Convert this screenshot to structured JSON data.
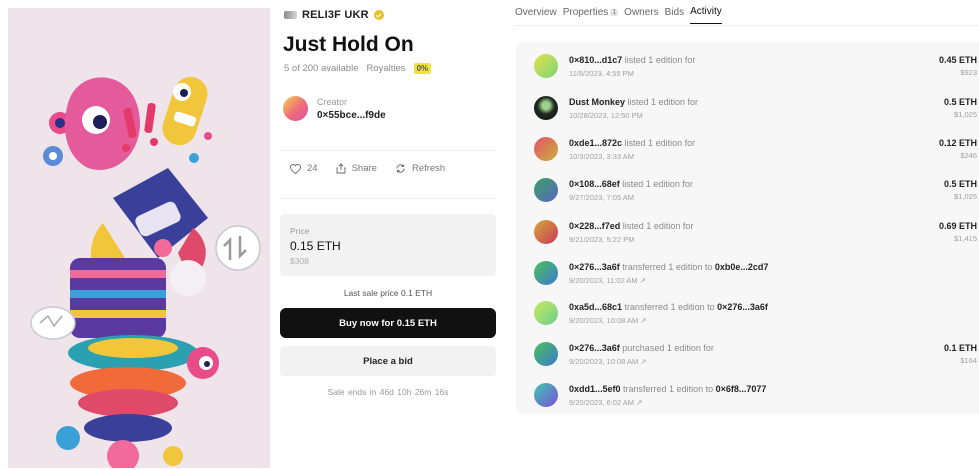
{
  "artist": {
    "name": "RELI3F UKR"
  },
  "item": {
    "title": "Just Hold On",
    "availability": "5 of 200 available",
    "royalties_label": "Royalties",
    "royalties_value": "0%"
  },
  "creator": {
    "label": "Creator",
    "address": "0×55bce...f9de"
  },
  "actions": {
    "likes": "24",
    "share": "Share",
    "refresh": "Refresh"
  },
  "price": {
    "label": "Price",
    "value": "0.15 ETH",
    "usd": "$308"
  },
  "last_sale": "Last sale price 0.1 ETH",
  "buttons": {
    "buy": "Buy now for 0.15 ETH",
    "bid": "Place a bid"
  },
  "sale_ends": "Sale ends in  46d  10h  26m  16s",
  "tabs": [
    {
      "label": "Overview",
      "active": false
    },
    {
      "label": "Properties",
      "count": "1",
      "active": false
    },
    {
      "label": "Owners",
      "active": false
    },
    {
      "label": "Bids",
      "active": false
    },
    {
      "label": "Activity",
      "active": true
    }
  ],
  "activity": [
    {
      "actor": "0×810...d1c7",
      "action": "listed 1 edition for",
      "target": "",
      "time": "11/8/2023, 4:55 PM",
      "arrow": false,
      "eth": "0.45 ETH",
      "usd": "$923",
      "avatar": "linear-gradient(135deg,#e6e04a,#7ad67a)"
    },
    {
      "actor": "Dust Monkey",
      "action": "listed 1 edition for",
      "target": "",
      "time": "10/28/2023, 12:50 PM",
      "arrow": false,
      "eth": "0.5 ETH",
      "usd": "$1,025",
      "avatar": "radial-gradient(circle at 50% 40%,#9bd18a 0 20%,#1f2a20 45%,#0b0f0b 100%)"
    },
    {
      "actor": "0xde1...872c",
      "action": "listed 1 edition for",
      "target": "",
      "time": "10/3/2023, 3:33 AM",
      "arrow": false,
      "eth": "0.12 ETH",
      "usd": "$246",
      "avatar": "linear-gradient(135deg,#e8506a,#c8b23a)"
    },
    {
      "actor": "0×108...68ef",
      "action": "listed 1 edition for",
      "target": "",
      "time": "9/27/2023, 7:05 AM",
      "arrow": false,
      "eth": "0.5 ETH",
      "usd": "$1,025",
      "avatar": "linear-gradient(135deg,#3aa060,#5a66c8)"
    },
    {
      "actor": "0×228...f7ed",
      "action": "listed 1 edition for",
      "target": "",
      "time": "9/21/2023, 5:22 PM",
      "arrow": false,
      "eth": "0.69 ETH",
      "usd": "$1,415",
      "avatar": "linear-gradient(135deg,#d6a93a,#c83a5a)"
    },
    {
      "actor": "0×276...3a6f",
      "action": "transferred 1 edition to",
      "target": "0xb0e...2cd7",
      "time": "9/20/2023, 11:02 AM",
      "arrow": true,
      "eth": "",
      "usd": "",
      "avatar": "linear-gradient(135deg,#4cc05a,#3a7ad0)"
    },
    {
      "actor": "0xa5d...68c1",
      "action": "transferred 1 edition to",
      "target": "0×276...3a6f",
      "time": "9/20/2023, 10:08 AM",
      "arrow": true,
      "eth": "",
      "usd": "",
      "avatar": "linear-gradient(135deg,#c8e860,#6ad08a)"
    },
    {
      "actor": "0×276...3a6f",
      "action": "purchased 1 edition for",
      "target": "",
      "time": "9/20/2023, 10:08 AM",
      "arrow": true,
      "eth": "0.1 ETH",
      "usd": "$164",
      "avatar": "linear-gradient(135deg,#4cc05a,#3a7ad0)"
    },
    {
      "actor": "0xdd1...5ef0",
      "action": "transferred 1 edition to",
      "target": "0×6f8...7077",
      "time": "9/20/2023, 6:02 AM",
      "arrow": true,
      "eth": "",
      "usd": "",
      "avatar": "linear-gradient(135deg,#40c8b0,#7a50d8)"
    }
  ]
}
